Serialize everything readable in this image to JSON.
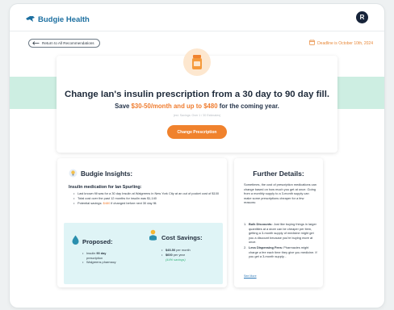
{
  "header": {
    "brand": "Budgie Health",
    "user_initial": "R",
    "back_label": "Return to All Recommendations",
    "deadline": "Deadline is October 10th, 2024"
  },
  "hero": {
    "title": "Change Ian's insulin prescription from a 30 day to 90 day fill.",
    "subtitle_prefix": "Save ",
    "subtitle_amount": "$30-50/month and up to $480",
    "subtitle_suffix": " for the coming year.",
    "note": "(est. Savings: Over 1 / 30 Estimates)",
    "cta_label": "Change Prescription"
  },
  "insights": {
    "heading": "Budgie Insights:",
    "subheading": "Insulin medication for Ian Spurling:",
    "bullets": [
      "Last known fill was for a 30 day Insulin at Walgreens in New York City at an out of pocket cost of $100",
      "Total cost over the past 12 months for insulin was $1,140"
    ],
    "bullet3_prefix": "Potential savings: ",
    "bullet3_amount": "$480",
    "bullet3_suffix": " if changed before next 30 day fill.",
    "proposed": {
      "title": "Proposed:",
      "item1_bold": "90 day",
      "item1_prefix": "Insulin ",
      "item1_suffix": " prescription",
      "item2": "Walgreens pharmacy"
    },
    "savings": {
      "title": "Cost Savings:",
      "item1_bold": "$45-50",
      "item1_suffix": " per month",
      "item2_bold": "$600",
      "item2_suffix": " per year",
      "pct": "(44% savings)"
    }
  },
  "details": {
    "title": "Further Details:",
    "body": "Sometimes, the cost of prescription medications can change based on how much you get at once. Going from a monthly supply to a 3-month supply can make some prescriptions cheaper for a few reasons:",
    "items": [
      {
        "num": "1.",
        "bold": "Bulk Discounts:",
        "text": " Just like buying things in larger quantities at a store can be cheaper per item, getting a 3-month supply of medicine might get you a discount because you're buying more at once."
      },
      {
        "num": "2.",
        "bold": "Less Dispensing Fees:",
        "text": " Pharmacies might charge a fee each time they give you medicine. If you get a 3-month supply..."
      }
    ],
    "see_more": "See More"
  },
  "colors": {
    "accent_orange": "#f0822d",
    "brand_blue": "#1c6fa0",
    "band_mint": "#cdeee2",
    "box_light_blue": "#dff4f6",
    "savings_green": "#35b27a"
  },
  "icons": [
    "budgie-logo-icon",
    "arrow-left-icon",
    "calendar-icon",
    "pill-bottle-icon",
    "lightbulb-icon",
    "water-drop-icon",
    "piggy-bank-icon"
  ]
}
